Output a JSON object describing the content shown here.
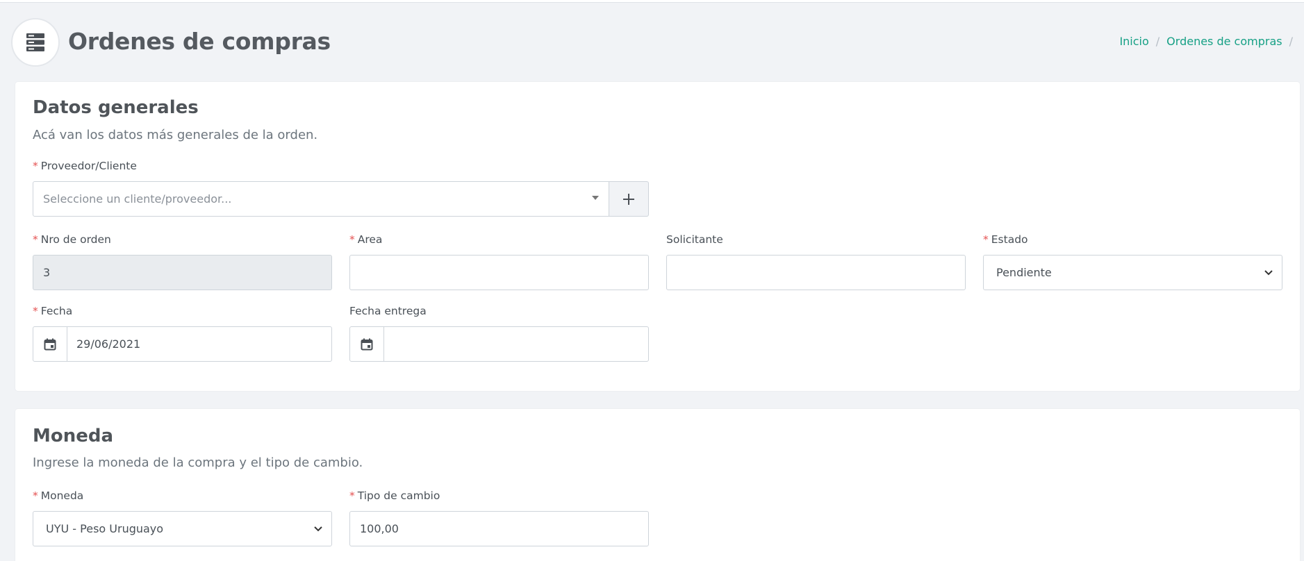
{
  "header": {
    "title": "Ordenes de compras",
    "icon": "server-icon",
    "breadcrumb": [
      "Inicio",
      "Ordenes de compras"
    ],
    "breadcrumb_separator": "/"
  },
  "general": {
    "title": "Datos generales",
    "description": "Acá van los datos más generales de la orden.",
    "proveedor": {
      "label": "Proveedor/Cliente",
      "required": "*",
      "placeholder": "Seleccione un cliente/proveedor..."
    },
    "nro_orden": {
      "label": "Nro de orden",
      "required": "*",
      "value": "3"
    },
    "area": {
      "label": "Area",
      "required": "*",
      "value": ""
    },
    "solicitante": {
      "label": "Solicitante",
      "value": ""
    },
    "estado": {
      "label": "Estado",
      "required": "*",
      "value": "Pendiente"
    },
    "fecha": {
      "label": "Fecha",
      "required": "*",
      "value": "29/06/2021"
    },
    "fecha_entrega": {
      "label": "Fecha entrega",
      "value": ""
    }
  },
  "moneda": {
    "title": "Moneda",
    "description": "Ingrese la moneda de la compra y el tipo de cambio.",
    "moneda": {
      "label": "Moneda",
      "required": "*",
      "value": "UYU - Peso Uruguayo"
    },
    "tipo_cambio": {
      "label": "Tipo de cambio",
      "required": "*",
      "value": "100,00"
    }
  },
  "colors": {
    "accent": "#16a085",
    "required": "#e55353",
    "background": "#f1f3f6"
  }
}
